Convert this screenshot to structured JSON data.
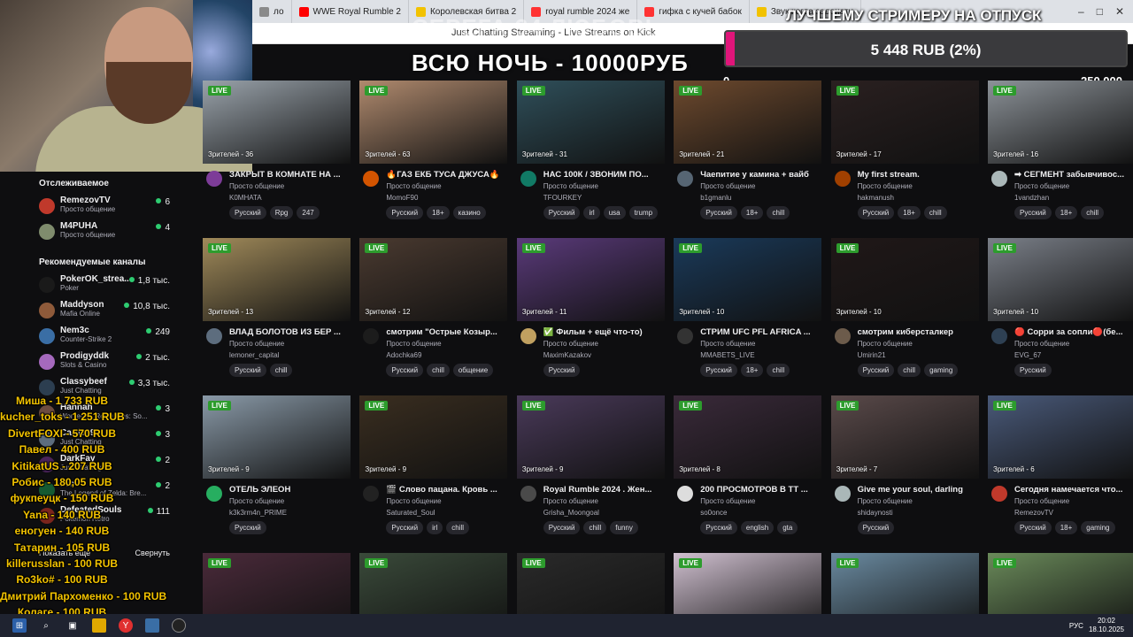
{
  "browser_tabs": [
    {
      "label": "ло",
      "icon": "tab-icon",
      "color": "#8a8a8a"
    },
    {
      "label": "WWE Royal Rumble 2",
      "icon": "youtube-icon",
      "color": "#ff0000"
    },
    {
      "label": "Королевская битва 2",
      "icon": "youtube-icon",
      "color": "#f2c200"
    },
    {
      "label": "royal rumble 2024 же",
      "icon": "yandex-icon",
      "color": "#ff3333"
    },
    {
      "label": "гифка с кучей бабок",
      "icon": "yandex-icon",
      "color": "#ff3333"
    },
    {
      "label": "Звук когда задонати",
      "icon": "youtube-icon",
      "color": "#f2c200"
    }
  ],
  "page_url": "Just Chatting Streaming - Live Streams on Kick",
  "overlay": {
    "title_top": "СЕРЕГА 34 ЛЮБОВЬ",
    "title_main": "ВСЮ НОЧЬ - 10000РУБ",
    "goal_title": "ЛУЧШЕМУ СТРИМЕРУ НА ОТПУСК",
    "goal_amount": "5 448 RUB (2%)",
    "goal_fraction": 0.022,
    "goal_min": "0",
    "goal_max": "250 000"
  },
  "sidebar": {
    "following_header": "Отслеживаемое",
    "following": [
      {
        "name": "RemezovTV",
        "category": "Просто общение",
        "viewers": "6",
        "color": "#c0392b"
      },
      {
        "name": "M4PUHA",
        "category": "Просто общение",
        "viewers": "4",
        "color": "#7f8c6d"
      }
    ],
    "recommended_header": "Рекомендуемые каналы",
    "recommended": [
      {
        "name": "PokerOK_strea...",
        "category": "Poker",
        "viewers": "1,8 тыс.",
        "color": "#1a1a1a"
      },
      {
        "name": "Maddyson",
        "category": "Mafia Online",
        "viewers": "10,8 тыс.",
        "color": "#8e5a3a"
      },
      {
        "name": "Nem3c",
        "category": "Counter-Strike 2",
        "viewers": "249",
        "color": "#3a6ea5"
      },
      {
        "name": "Prodigyddk",
        "category": "Slots & Casino",
        "viewers": "2 тыс.",
        "color": "#a569bd"
      },
      {
        "name": "Classybeef",
        "category": "Just Chatting",
        "viewers": "3,3 тыс.",
        "color": "#2c3e50"
      },
      {
        "name": "Hannah",
        "category": "Workers & Resources: So...",
        "viewers": "3",
        "color": "#6d4c41"
      },
      {
        "name": "Carti999",
        "category": "Just Chatting",
        "viewers": "3",
        "color": "#5d6d7e"
      },
      {
        "name": "DarkFay",
        "category": "Just Chatting",
        "viewers": "2",
        "color": "#4a235a"
      },
      {
        "name": "Pro",
        "category": "The Legend of Zelda: Bre...",
        "viewers": "2",
        "color": "#145a32"
      },
      {
        "name": "DefeatedSouls",
        "category": "Pokemon Retro",
        "viewers": "111",
        "color": "#7b241c"
      }
    ],
    "show_more": "Показать еще",
    "collapse": "Свернуть"
  },
  "donations": [
    "Миша - 1 733 RUB",
    "kucher_toks - 1 251 RUB",
    "DivertFOXI - 570 RUB",
    "Павел - 400 RUB",
    "KitikatUS - 207 RUB",
    "Робис - 180,05 RUB",
    "фукпеуцк - 150 RUB",
    "Yana - 140 RUB",
    "еногуен - 140 RUB",
    "Татарин - 105 RUB",
    "killerusslan - 100 RUB",
    "Ro3ko# - 100 RUB",
    "Дмитрий Пархоменко - 100 RUB",
    "Колаге - 100 RUB"
  ],
  "live_badge": "LIVE",
  "streams": [
    {
      "views": "Зрителей - 36",
      "title": "ЗАКРЫТ В КОМНАТЕ НА ...",
      "cat": "Просто общение",
      "channel": "K0MHATA",
      "tags": [
        "Русский",
        "Rpg",
        "247"
      ],
      "thumb": "#9aa3ab",
      "av": "#7d3c98"
    },
    {
      "views": "Зрителей - 63",
      "title": "🔥ГАЗ ЕКБ ТУСА ДЖУСА🔥",
      "cat": "Просто общение",
      "channel": "MomoF90",
      "tags": [
        "Русский",
        "18+",
        "казино"
      ],
      "thumb": "#b08a6e",
      "av": "#d35400"
    },
    {
      "views": "Зрителей - 31",
      "title": "НАС 100К / ЗВОНИМ ПО...",
      "cat": "Просто общение",
      "channel": "TFOURKEY",
      "tags": [
        "Русский",
        "irl",
        "usa",
        "trump"
      ],
      "thumb": "#2f4f5a",
      "av": "#117a65"
    },
    {
      "views": "Зрителей - 21",
      "title": "Чаепитие у камина + вайб",
      "cat": "Просто общение",
      "channel": "b1gmanlu",
      "tags": [
        "Русский",
        "18+",
        "chill"
      ],
      "thumb": "#6e4a2e",
      "av": "#566573"
    },
    {
      "views": "Зрителей - 17",
      "title": "My first stream.",
      "cat": "Просто общение",
      "channel": "hakmanush",
      "tags": [
        "Русский",
        "18+",
        "chill"
      ],
      "thumb": "#2a2020",
      "av": "#a04000"
    },
    {
      "views": "Зрителей - 16",
      "title": "➡ СЕГМЕНТ забывчивос...",
      "cat": "Просто общение",
      "channel": "1vandzhan",
      "tags": [
        "Русский",
        "18+",
        "chill"
      ],
      "thumb": "#8c9298",
      "av": "#aab7b8"
    },
    {
      "views": "Зрителей - 13",
      "title": "ВЛАД БОЛОТОВ ИЗ БЕР ...",
      "cat": "Просто общение",
      "channel": "lemoner_capital",
      "tags": [
        "Русский",
        "chill"
      ],
      "thumb": "#a08a5a",
      "av": "#5d6d7e"
    },
    {
      "views": "Зрителей - 12",
      "title": "смотрим \"Острые Козыр...",
      "cat": "Просто общение",
      "channel": "Adochka69",
      "tags": [
        "Русский",
        "chill",
        "общение"
      ],
      "thumb": "#4a3a30",
      "av": "#1c1c1c"
    },
    {
      "views": "Зрителей - 11",
      "title": "✅ Фильм + ещё что-то)",
      "cat": "Просто общение",
      "channel": "MaximKazakov",
      "tags": [
        "Русский"
      ],
      "thumb": "#5a3a7a",
      "av": "#c0a060"
    },
    {
      "views": "Зрителей - 10",
      "title": "СТРИМ UFC PFL AFRICA ...",
      "cat": "Просто общение",
      "channel": "MMABETS_LIVE",
      "tags": [
        "Русский",
        "18+",
        "chill"
      ],
      "thumb": "#1a3a5a",
      "av": "#333333"
    },
    {
      "views": "Зрителей - 10",
      "title": "смотрим киберсталкер",
      "cat": "Просто общение",
      "channel": "Umirin21",
      "tags": [
        "Русский",
        "chill",
        "gaming"
      ],
      "thumb": "#201818",
      "av": "#6c5b4b"
    },
    {
      "views": "Зрителей - 10",
      "title": "🔴 Сорри за сопли🔴(бе...",
      "cat": "Просто общение",
      "channel": "EVG_67",
      "tags": [
        "Русский"
      ],
      "thumb": "#7a7f88",
      "av": "#2e4053"
    },
    {
      "views": "Зрителей - 9",
      "title": "ОТЕЛЬ ЭЛЕОН",
      "cat": "Просто общение",
      "channel": "k3k3rm4n_PRIME",
      "tags": [
        "Русский"
      ],
      "thumb": "#8a9aa8",
      "av": "#27ae60"
    },
    {
      "views": "Зрителей - 9",
      "title": "🎬 Слово пацана. Кровь ...",
      "cat": "Просто общение",
      "channel": "Saturated_Soul",
      "tags": [
        "Русский",
        "irl",
        "chill"
      ],
      "thumb": "#3a2e20",
      "av": "#222222"
    },
    {
      "views": "Зрителей - 9",
      "title": "Royal Rumble 2024 . Жен...",
      "cat": "Просто общение",
      "channel": "Grisha_Moongoal",
      "tags": [
        "Русский",
        "chill",
        "funny"
      ],
      "thumb": "#4a3a5a",
      "av": "#4a4a4a"
    },
    {
      "views": "Зрителей - 8",
      "title": "200 ПРОСМОТРОВ В ТТ ...",
      "cat": "Просто общение",
      "channel": "so0once",
      "tags": [
        "Русский",
        "english",
        "gta"
      ],
      "thumb": "#3a2a3a",
      "av": "#dddddd"
    },
    {
      "views": "Зрителей - 7",
      "title": "Give me your soul, darling",
      "cat": "Просто общение",
      "channel": "shidaynosti",
      "tags": [
        "Русский"
      ],
      "thumb": "#5a4a4a",
      "av": "#aab7b8"
    },
    {
      "views": "Зрителей - 6",
      "title": "Сегодня намечается что...",
      "cat": "Просто общение",
      "channel": "RemezovTV",
      "tags": [
        "Русский",
        "18+",
        "gaming"
      ],
      "thumb": "#4a5a7a",
      "av": "#c0392b"
    },
    {
      "views": "",
      "title": "",
      "cat": "",
      "channel": "",
      "tags": [],
      "thumb": "#4a2a3a",
      "av": ""
    },
    {
      "views": "",
      "title": "",
      "cat": "",
      "channel": "",
      "tags": [],
      "thumb": "#3a4a3a",
      "av": ""
    },
    {
      "views": "",
      "title": "",
      "cat": "",
      "channel": "",
      "tags": [],
      "thumb": "#2a2a2a",
      "av": ""
    },
    {
      "views": "",
      "title": "",
      "cat": "",
      "channel": "",
      "tags": [],
      "thumb": "#d0c0d0",
      "av": ""
    },
    {
      "views": "",
      "title": "",
      "cat": "",
      "channel": "",
      "tags": [],
      "thumb": "#6a8aa0",
      "av": ""
    },
    {
      "views": "",
      "title": "",
      "cat": "",
      "channel": "",
      "tags": [],
      "thumb": "#6a8a5a",
      "av": ""
    }
  ],
  "taskbar": {
    "lang": "РУС",
    "time": "20:02",
    "date": "18.10.2025",
    "icons": [
      "windows-icon",
      "search-icon",
      "taskview-icon",
      "file-explorer-icon",
      "yandex-browser-icon",
      "app-icon",
      "obs-icon"
    ]
  }
}
